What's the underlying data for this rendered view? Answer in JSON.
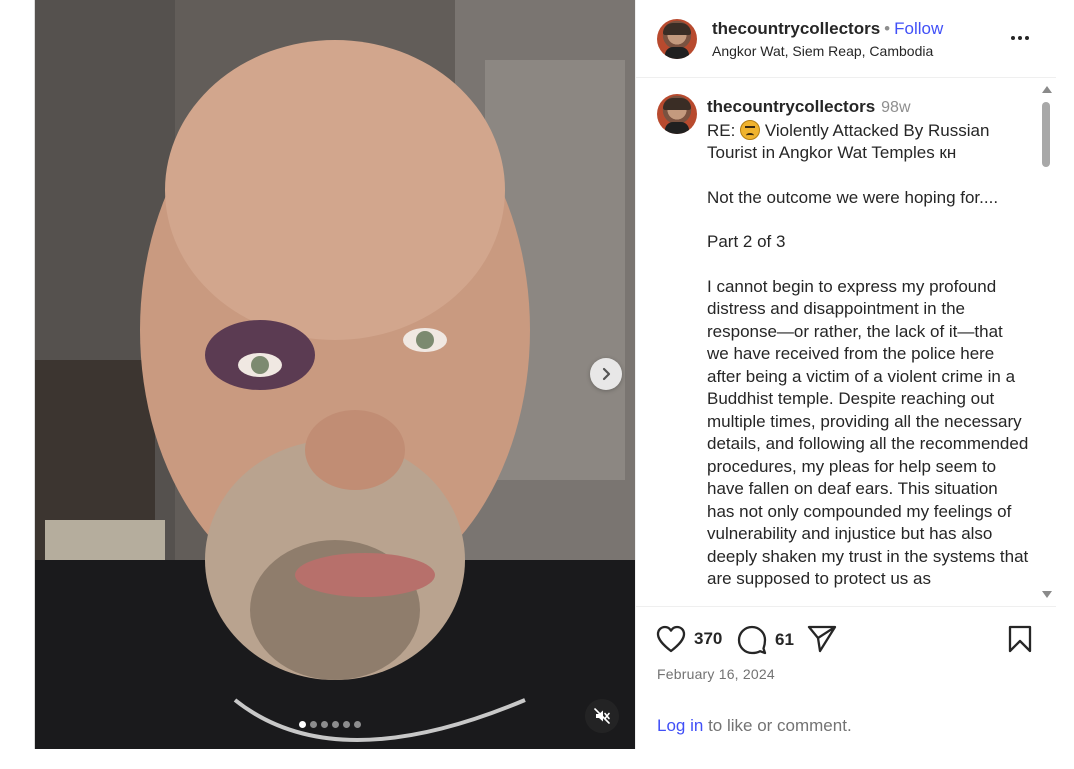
{
  "post": {
    "username": "thecountrycollectors",
    "separator": "•",
    "follow_label": "Follow",
    "location": "Angkor Wat, Siem Reap, Cambodia",
    "more_icon": "more-options-icon"
  },
  "media": {
    "carousel_total": 6,
    "carousel_active_index": 0,
    "next_icon": "chevron-right-icon",
    "mute_icon": "muted-audio-icon"
  },
  "caption": {
    "username": "thecountrycollectors",
    "time": "98w",
    "title_prefix": "RE:",
    "title_emoji": "confounded-face-emoji",
    "title_text": "Violently Attacked By Russian Tourist in Angkor Wat Temples кн",
    "paragraph_1": "Not the outcome we were hoping for....",
    "paragraph_2": "Part 2 of 3",
    "paragraph_3": "I cannot begin to express my profound distress and disappointment in the response—or rather, the lack of it—that we have received from the police here after being a victim of a violent crime in a Buddhist temple. Despite reaching out multiple times, providing all the necessary details, and following all the recommended procedures, my pleas for help seem to have fallen on deaf ears. This situation has not only compounded my feelings of vulnerability and injustice but has also deeply shaken my trust in the systems that are supposed to protect us as"
  },
  "actions": {
    "like_icon": "heart-icon",
    "likes": "370",
    "comment_icon": "comment-icon",
    "comments": "61",
    "share_icon": "share-icon",
    "save_icon": "bookmark-icon",
    "date": "February 16, 2024",
    "login_link": "Log in",
    "login_suffix": "to like or comment."
  },
  "colors": {
    "link_blue": "#4150f7",
    "muted_text": "#737373",
    "border": "#dbdbdb"
  }
}
